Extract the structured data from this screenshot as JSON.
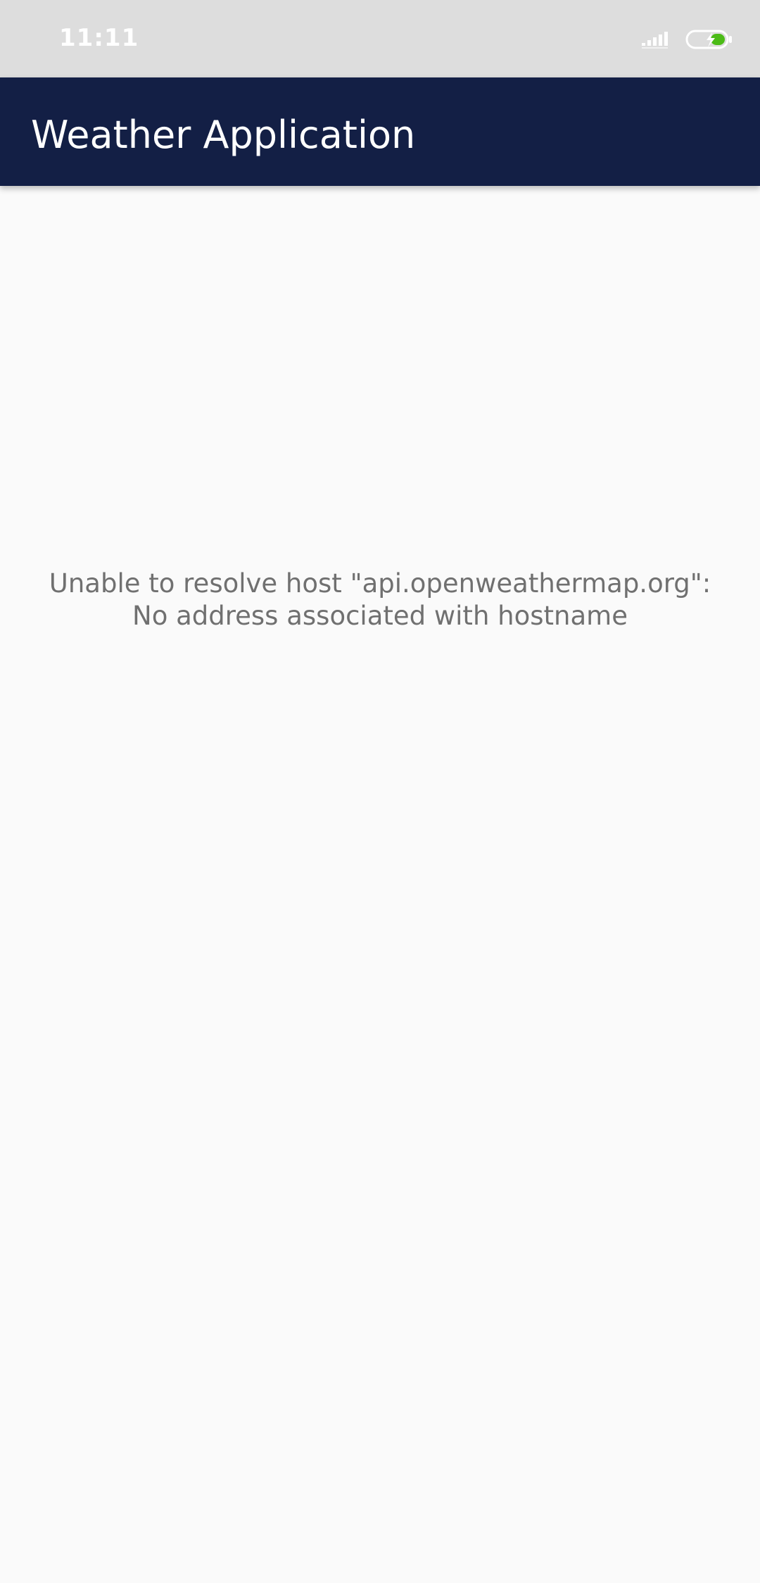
{
  "status_bar": {
    "time": "11:11",
    "icons": [
      "signal-icon",
      "battery-charging-icon"
    ],
    "battery_color": "#4cbb17"
  },
  "app_bar": {
    "title": "Weather Application",
    "background": "#131f45"
  },
  "main": {
    "error_message": "Unable to resolve host \"api.openweathermap.org\": No address associated with hostname"
  }
}
